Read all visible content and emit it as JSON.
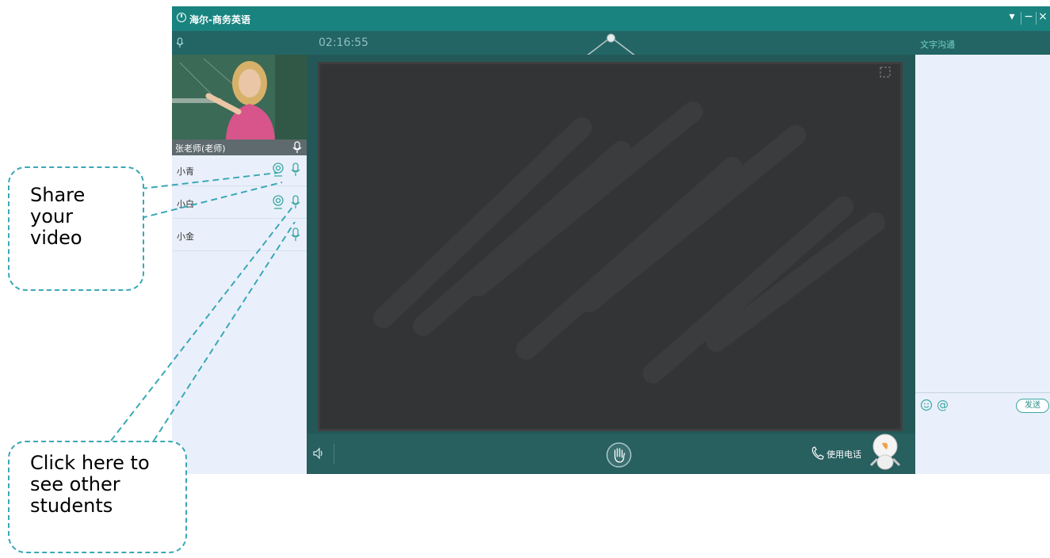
{
  "window": {
    "title": "海尔-商务英语"
  },
  "session": {
    "timer": "02:16:55"
  },
  "teacher": {
    "name": "张老师(老师)"
  },
  "students": [
    {
      "name": "小青"
    },
    {
      "name": "小白"
    },
    {
      "name": "小金"
    }
  ],
  "chat": {
    "label": "文字沟通",
    "send_label": "发送"
  },
  "footer": {
    "call_label": "使用电话"
  },
  "callouts": {
    "share_video": [
      "Share",
      "your",
      "video"
    ],
    "other_students": [
      "Click here to",
      "see other",
      "students"
    ]
  },
  "colors": {
    "titlebar": "#19837f",
    "accent": "#3aa8b6",
    "board": "#333435",
    "panel": "#eaf0fb"
  },
  "icons": [
    "clock-icon",
    "microphone-icon",
    "camera-icon",
    "fullscreen-icon",
    "speaker-icon",
    "raise-hand-icon",
    "phone-icon",
    "smiley-icon",
    "at-icon",
    "mascot-icon"
  ]
}
